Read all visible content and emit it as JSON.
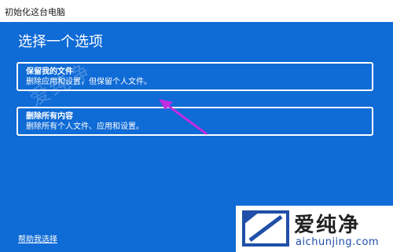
{
  "window": {
    "title": "初始化这台电脑"
  },
  "dialog": {
    "heading": "选择一个选项",
    "options": [
      {
        "title": "保留我的文件",
        "description": "删除应用和设置，但保留个人文件。"
      },
      {
        "title": "删除所有内容",
        "description": "删除所有个人文件、应用和设置。"
      }
    ],
    "help_link": "帮助我选择"
  },
  "watermark": {
    "diagonal_text": "爱纯净",
    "logo_text": "爱纯净",
    "logo_url": "aichunjing.com"
  },
  "colors": {
    "panel_background": "#0f6bd6",
    "arrow": "#c02de0"
  }
}
